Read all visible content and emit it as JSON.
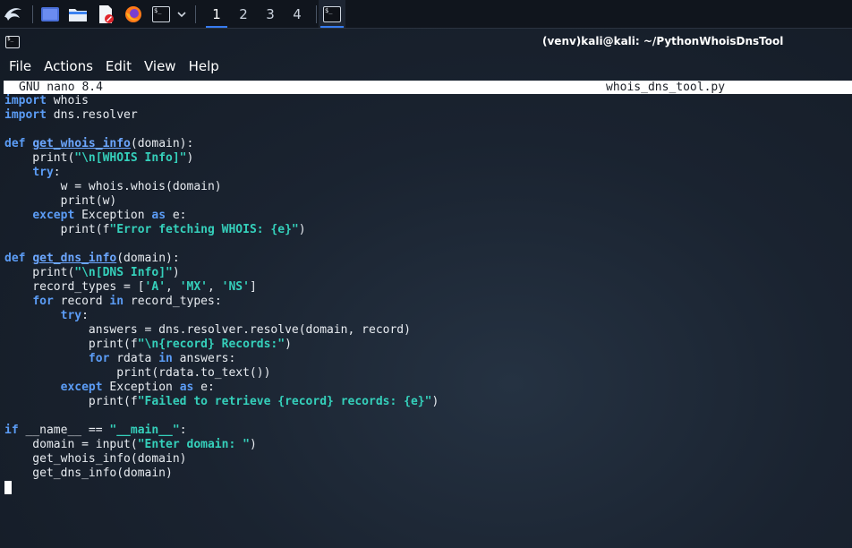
{
  "taskbar": {
    "workspaces": [
      "1",
      "2",
      "3",
      "4"
    ],
    "active_workspace": "1",
    "icons": [
      "kali-dragon-icon",
      "desktop-icon",
      "files-icon",
      "text-editor-icon",
      "firefox-icon",
      "terminal-icon",
      "chevron-down-icon"
    ]
  },
  "window": {
    "title": "(venv)kali@kali: ~/PythonWhoisDnsTool"
  },
  "menu": {
    "file": "File",
    "actions": "Actions",
    "edit": "Edit",
    "view": "View",
    "help": "Help"
  },
  "nano": {
    "version": "GNU nano 8.4",
    "filename": "whois_dns_tool.py"
  },
  "code_lines": [
    [
      [
        "kw",
        "import"
      ],
      [
        "t",
        " whois"
      ]
    ],
    [
      [
        "kw",
        "import"
      ],
      [
        "t",
        " dns.resolver"
      ]
    ],
    [],
    [
      [
        "kw",
        "def"
      ],
      [
        "t",
        " "
      ],
      [
        "fn",
        "get_whois_info"
      ],
      [
        "t",
        "(domain):"
      ]
    ],
    [
      [
        "t",
        "    print("
      ],
      [
        "str",
        "\"\\n[WHOIS Info]\""
      ],
      [
        "t",
        ")"
      ]
    ],
    [
      [
        "t",
        "    "
      ],
      [
        "kw",
        "try"
      ],
      [
        "t",
        ":"
      ]
    ],
    [
      [
        "t",
        "        w = whois.whois(domain)"
      ]
    ],
    [
      [
        "t",
        "        print(w)"
      ]
    ],
    [
      [
        "t",
        "    "
      ],
      [
        "kw",
        "except"
      ],
      [
        "t",
        " Exception "
      ],
      [
        "kw",
        "as"
      ],
      [
        "t",
        " e:"
      ]
    ],
    [
      [
        "t",
        "        print(f"
      ],
      [
        "str",
        "\"Error fetching WHOIS: {e}\""
      ],
      [
        "t",
        ")"
      ]
    ],
    [],
    [
      [
        "kw",
        "def"
      ],
      [
        "t",
        " "
      ],
      [
        "fn",
        "get_dns_info"
      ],
      [
        "t",
        "(domain):"
      ]
    ],
    [
      [
        "t",
        "    print("
      ],
      [
        "str",
        "\"\\n[DNS Info]\""
      ],
      [
        "t",
        ")"
      ]
    ],
    [
      [
        "t",
        "    record_types = ["
      ],
      [
        "str",
        "'A'"
      ],
      [
        "t",
        ", "
      ],
      [
        "str",
        "'MX'"
      ],
      [
        "t",
        ", "
      ],
      [
        "str",
        "'NS'"
      ],
      [
        "t",
        "]"
      ]
    ],
    [
      [
        "t",
        "    "
      ],
      [
        "kw",
        "for"
      ],
      [
        "t",
        " record "
      ],
      [
        "kw",
        "in"
      ],
      [
        "t",
        " record_types:"
      ]
    ],
    [
      [
        "t",
        "        "
      ],
      [
        "kw",
        "try"
      ],
      [
        "t",
        ":"
      ]
    ],
    [
      [
        "t",
        "            answers = dns.resolver.resolve(domain, record)"
      ]
    ],
    [
      [
        "t",
        "            print(f"
      ],
      [
        "str",
        "\"\\n{record} Records:\""
      ],
      [
        "t",
        ")"
      ]
    ],
    [
      [
        "t",
        "            "
      ],
      [
        "kw",
        "for"
      ],
      [
        "t",
        " rdata "
      ],
      [
        "kw",
        "in"
      ],
      [
        "t",
        " answers:"
      ]
    ],
    [
      [
        "t",
        "                print(rdata.to_text())"
      ]
    ],
    [
      [
        "t",
        "        "
      ],
      [
        "kw",
        "except"
      ],
      [
        "t",
        " Exception "
      ],
      [
        "kw",
        "as"
      ],
      [
        "t",
        " e:"
      ]
    ],
    [
      [
        "t",
        "            print(f"
      ],
      [
        "str",
        "\"Failed to retrieve {record} records: {e}\""
      ],
      [
        "t",
        ")"
      ]
    ],
    [],
    [
      [
        "kw",
        "if"
      ],
      [
        "t",
        " __name__ == "
      ],
      [
        "str",
        "\"__main__\""
      ],
      [
        "t",
        ":"
      ]
    ],
    [
      [
        "t",
        "    domain = input("
      ],
      [
        "str",
        "\"Enter domain: \""
      ],
      [
        "t",
        ")"
      ]
    ],
    [
      [
        "t",
        "    get_whois_info(domain)"
      ]
    ],
    [
      [
        "t",
        "    get_dns_info(domain)"
      ]
    ]
  ]
}
